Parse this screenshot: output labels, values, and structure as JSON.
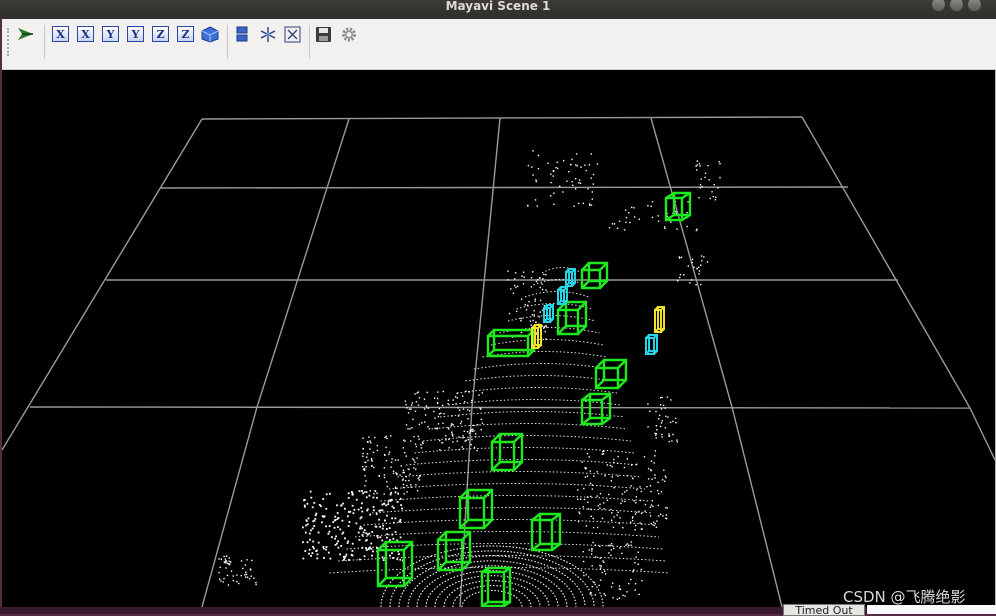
{
  "window": {
    "title": "Mayavi Scene 1"
  },
  "toolbar": {
    "buttons": [
      {
        "name": "pipeline-button",
        "icon": "mayavi-pipeline-icon"
      },
      {
        "name": "view-x-plus-button",
        "label": "X"
      },
      {
        "name": "view-x-minus-button",
        "label": "X"
      },
      {
        "name": "view-y-plus-button",
        "label": "Y"
      },
      {
        "name": "view-y-minus-button",
        "label": "Y"
      },
      {
        "name": "view-z-plus-button",
        "label": "Z"
      },
      {
        "name": "view-z-minus-button",
        "label": "Z"
      },
      {
        "name": "isometric-button",
        "icon": "cube-icon"
      },
      {
        "name": "parallel-projection-button",
        "icon": "projection-icon"
      },
      {
        "name": "axes-toggle-button",
        "icon": "axes-icon"
      },
      {
        "name": "fullscreen-button",
        "icon": "fullscreen-icon"
      },
      {
        "name": "save-button",
        "icon": "save-icon"
      },
      {
        "name": "configure-button",
        "icon": "gear-icon"
      }
    ]
  },
  "scene": {
    "background": "#000000",
    "grid_color": "#9a9a9a",
    "point_color": "#ffffff",
    "car_box_color": "#1ee81e",
    "pedestrian_box_color": "#22d6e8",
    "cyclist_box_color": "#f2e32a"
  },
  "status_bar": {
    "text": "Timed Out"
  },
  "watermark": "CSDN @飞腾绝影"
}
